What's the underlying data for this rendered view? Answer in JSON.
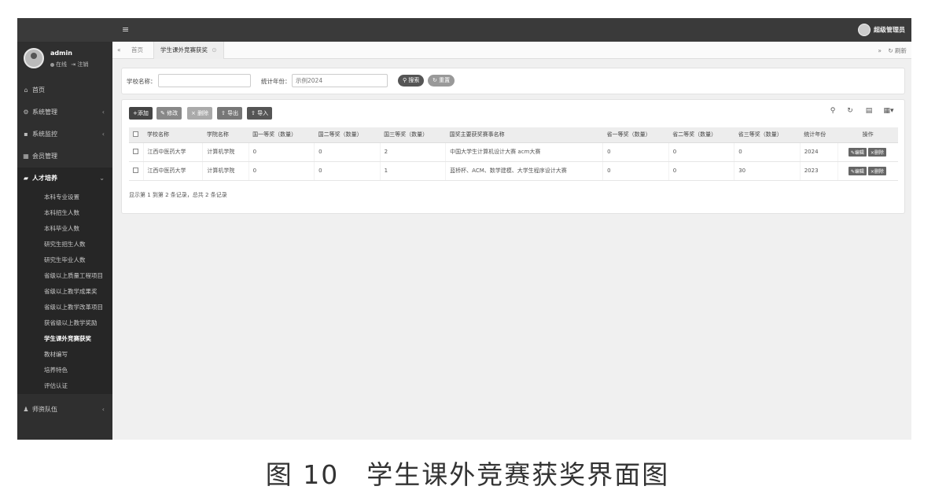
{
  "sidebar": {
    "user": {
      "name": "admin",
      "status": "在线",
      "logout": "注销"
    },
    "items": [
      {
        "icon": "home-icon",
        "label": "首页"
      },
      {
        "icon": "gear-icon",
        "label": "系统管理",
        "chevron": "‹"
      },
      {
        "icon": "monitor-icon",
        "label": "系统监控",
        "chevron": "‹"
      },
      {
        "icon": "members-icon",
        "label": "会员管理"
      },
      {
        "icon": "talent-icon",
        "label": "人才培养",
        "chevron": "⌄"
      }
    ],
    "subitems": [
      "本科专业设置",
      "本科招生人数",
      "本科毕业人数",
      "研究生招生人数",
      "研究生毕业人数",
      "省级以上质量工程项目",
      "省级以上教学成果奖",
      "省级以上教学改革项目",
      "获省级以上教学奖励",
      "学生课外竞赛获奖",
      "教材编写",
      "培养特色",
      "评估认证"
    ],
    "active_sub": "学生课外竞赛获奖",
    "bottom_item": {
      "icon": "team-icon",
      "label": "师资队伍",
      "chevron": "‹"
    }
  },
  "topbar": {
    "menu_icon": "≡",
    "admin_label": "超级管理员"
  },
  "tabs": {
    "home": "首页",
    "active": "学生课外竞赛获奖",
    "refresh": "刷新"
  },
  "search": {
    "school_label": "学校名称：",
    "year_label": "统计年份：",
    "year_placeholder": "示例2024",
    "search_button": "搜索",
    "reset_button": "重置"
  },
  "toolbar": {
    "add": "添加",
    "edit": "修改",
    "delete": "删除",
    "export": "导出",
    "import": "导入"
  },
  "table": {
    "columns": [
      "学校名称",
      "学院名称",
      "国一等奖（数量）",
      "国二等奖（数量）",
      "国三等奖（数量）",
      "国奖主要获奖赛事名称",
      "省一等奖（数量）",
      "省二等奖（数量）",
      "省三等奖（数量）",
      "统计年份",
      "操作"
    ],
    "rows": [
      [
        "江西中医药大学",
        "计算机学院",
        "0",
        "0",
        "2",
        "中国大学生计算机设计大赛 acm大赛",
        "0",
        "0",
        "0",
        "2024"
      ],
      [
        "江西中医药大学",
        "计算机学院",
        "0",
        "0",
        "1",
        "蓝桥杯、ACM、数学建模、大学生程序设计大赛",
        "0",
        "0",
        "30",
        "2023"
      ]
    ],
    "row_edit": "编辑",
    "row_delete": "删除",
    "footer": "显示第 1 到第 2 条记录，总共 2 条记录"
  },
  "caption": "图 10　学生课外竞赛获奖界面图"
}
